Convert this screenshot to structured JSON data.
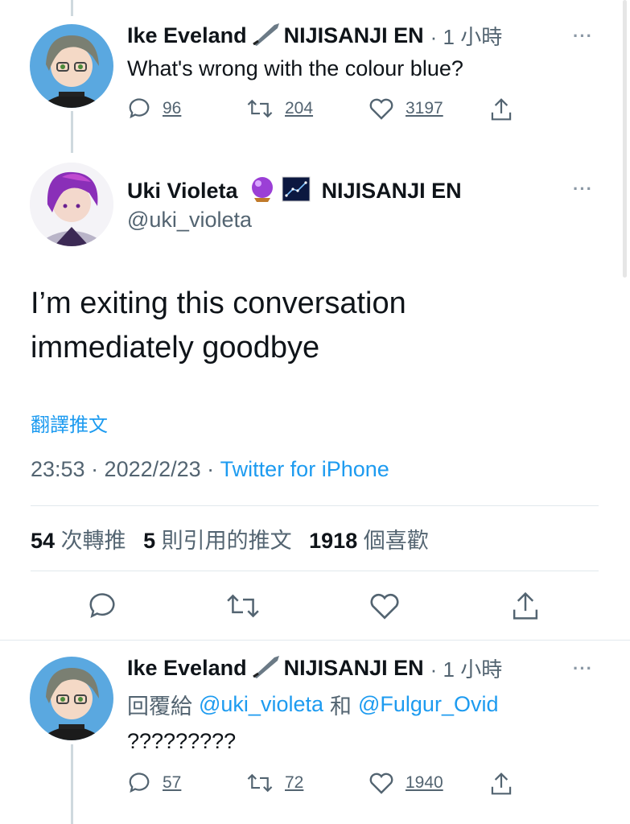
{
  "tweets": {
    "top_reply": {
      "author_name": "Ike Eveland",
      "author_suffix": "NIJISANJI EN",
      "time": "· 1 小時",
      "text": "What's wrong with the colour blue?",
      "counts": {
        "reply": "96",
        "retweet": "204",
        "like": "3197"
      }
    },
    "main": {
      "author_name": "Uki Violeta",
      "author_suffix": "NIJISANJI EN",
      "handle": "@uki_violeta",
      "text_line1": "I’m exiting this conversation",
      "text_line2": "immediately goodbye",
      "translate": "翻譯推文",
      "time": "23:53 · 2022/2/23 · ",
      "source": "Twitter for iPhone",
      "stats": {
        "retweets": "54",
        "retweets_label": "次轉推",
        "quotes": "5",
        "quotes_label": "則引用的推文",
        "likes": "1918",
        "likes_label": "個喜歡"
      }
    },
    "bottom_reply": {
      "author_name": "Ike Eveland",
      "author_suffix": "NIJISANJI EN",
      "time": "· 1 小時",
      "reply_to_prefix": "回覆給",
      "reply_to_user1": "@uki_violeta",
      "reply_to_join": "和",
      "reply_to_user2": "@Fulgur_Ovid",
      "text": "?????????",
      "counts": {
        "reply": "57",
        "retweet": "72",
        "like": "1940"
      }
    }
  },
  "more_label": "···",
  "colors": {
    "accent": "#1d9bf0",
    "muted": "#536471",
    "divider": "#e1e8ed"
  },
  "icons": [
    "reply-icon",
    "retweet-icon",
    "like-icon",
    "share-icon",
    "quill-icon",
    "crystal-ball-icon",
    "constellation-icon"
  ]
}
